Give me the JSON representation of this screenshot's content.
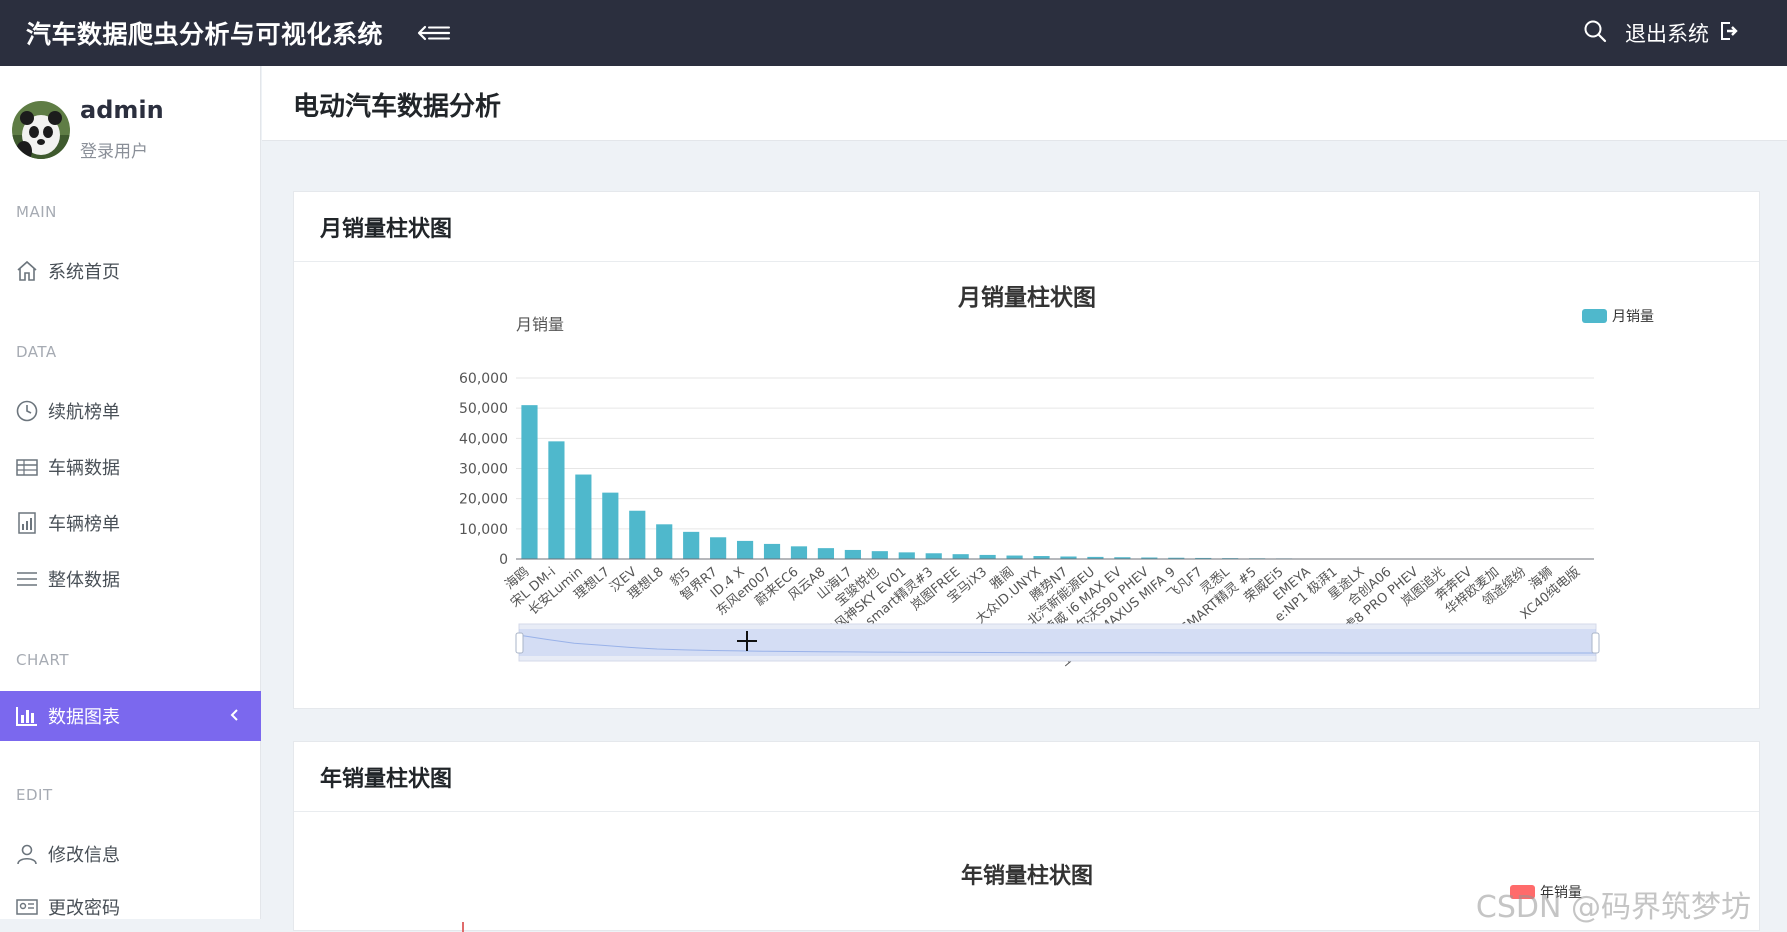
{
  "app": {
    "title": "汽车数据爬虫分析与可视化系统",
    "logout_label": "退出系统"
  },
  "user": {
    "name": "admin",
    "role": "登录用户"
  },
  "sidebar": {
    "sections": [
      {
        "label": "MAIN"
      },
      {
        "label": "DATA"
      },
      {
        "label": "CHART"
      },
      {
        "label": "EDIT"
      }
    ],
    "items": [
      {
        "label": "系统首页",
        "icon": "home-icon"
      },
      {
        "label": "续航榜单",
        "icon": "clock-icon"
      },
      {
        "label": "车辆数据",
        "icon": "table-icon"
      },
      {
        "label": "车辆榜单",
        "icon": "report-icon"
      },
      {
        "label": "整体数据",
        "icon": "list-icon"
      },
      {
        "label": "数据图表",
        "icon": "bar-chart-icon",
        "active": true
      },
      {
        "label": "修改信息",
        "icon": "user-icon"
      },
      {
        "label": "更改密码",
        "icon": "id-card-icon"
      }
    ]
  },
  "page": {
    "title": "电动汽车数据分析"
  },
  "cards": [
    {
      "title": "月销量柱状图"
    },
    {
      "title": "年销量柱状图"
    }
  ],
  "colors": {
    "accent": "#7b68ee",
    "bar": "#4fb8cc",
    "topbar": "#2b2f3e",
    "legend2": "#ff6b6b"
  },
  "chart_data": [
    {
      "type": "bar",
      "title": "月销量柱状图",
      "ylabel": "月销量",
      "ylim": [
        0,
        60000
      ],
      "yticks": [
        "0",
        "10,000",
        "20,000",
        "30,000",
        "40,000",
        "50,000",
        "60,000"
      ],
      "legend": {
        "label": "月销量",
        "position": "top-right"
      },
      "categories": [
        "海鸥",
        "宋L DM-i",
        "长安Lumin",
        "理想L7",
        "汉EV",
        "理想L8",
        "豹5",
        "智界R7",
        "ID.4 X",
        "东风eπ007",
        "蔚来EC6",
        "风云A8",
        "山海L7",
        "宝骏悦也",
        "东风风神SKY EV01",
        "smart精灵#3",
        "岚图FREE",
        "宝马iX3",
        "雅阁",
        "大众ID.UNYX",
        "腾势N7",
        "北汽新能源EU",
        "荣威 i6 MAX EV",
        "沃尔沃S90 PHEV",
        "上汽大通MAXUS MIFA 9",
        "飞凡F7",
        "灵悉L",
        "SMART精灵 #5",
        "荣威Ei5",
        "EMEYA",
        "e:NP1 极湃1",
        "星途LX",
        "合创A06",
        "瑞虎8 PRO PHEV",
        "岚图追光",
        "奔奔EV",
        "华梓欧麦加",
        "领途缤纷",
        "海狮",
        "XC40纯电版"
      ],
      "series": [
        {
          "name": "月销量",
          "values": [
            51000,
            39000,
            28000,
            22000,
            16000,
            11500,
            9000,
            7200,
            6000,
            5000,
            4200,
            3600,
            3000,
            2600,
            2200,
            1900,
            1600,
            1350,
            1150,
            980,
            830,
            700,
            590,
            500,
            420,
            350,
            290,
            240,
            200,
            160,
            130,
            105,
            85,
            68,
            54,
            42,
            32,
            24,
            17,
            12
          ]
        }
      ],
      "datazoom": {
        "start_percent": 0,
        "end_percent": 100
      }
    },
    {
      "type": "bar",
      "title": "年销量柱状图",
      "legend": {
        "label": "年销量",
        "position": "top-right"
      }
    }
  ],
  "watermark": "CSDN @码界筑梦坊"
}
